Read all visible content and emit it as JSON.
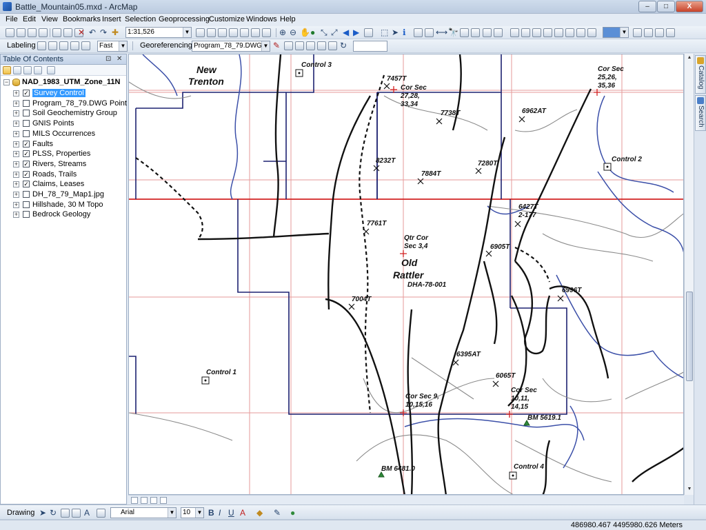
{
  "window": {
    "title": "Battle_Mountain05.mxd - ArcMap",
    "min_label": "–",
    "max_label": "□",
    "close_label": "X"
  },
  "menu": [
    "File",
    "Edit",
    "View",
    "Bookmarks",
    "Insert",
    "Selection",
    "Geoprocessing",
    "Customize",
    "Windows",
    "Help"
  ],
  "toolbar": {
    "scale_value": "1:31,526",
    "labeling_label": "Labeling",
    "quality_value": "Fast",
    "georeferencing_label": "Georeferencing",
    "layer_value": "Program_78_79.DWG Poi"
  },
  "toc": {
    "title": "Table Of Contents",
    "pin": "⊡",
    "close": "✕",
    "dataframe": "NAD_1983_UTM_Zone_11N",
    "layers": [
      {
        "label": "Survey Control",
        "checked": true,
        "selected": true
      },
      {
        "label": "Program_78_79.DWG Point",
        "checked": false,
        "selected": false
      },
      {
        "label": "Soil Geochemistry Group",
        "checked": false,
        "selected": false
      },
      {
        "label": "GNIS Points",
        "checked": false,
        "selected": false
      },
      {
        "label": "MILS Occurrences",
        "checked": false,
        "selected": false
      },
      {
        "label": "Faults",
        "checked": true,
        "selected": false
      },
      {
        "label": "PLSS, Properties",
        "checked": true,
        "selected": false
      },
      {
        "label": "Rivers, Streams",
        "checked": true,
        "selected": false
      },
      {
        "label": "Roads, Trails",
        "checked": true,
        "selected": false
      },
      {
        "label": "Claims, Leases",
        "checked": true,
        "selected": false
      },
      {
        "label": "DH_78_79_Map1.jpg",
        "checked": false,
        "selected": false
      },
      {
        "label": "Hillshade, 30 M Topo",
        "checked": false,
        "selected": false
      },
      {
        "label": "Bedrock Geology",
        "checked": false,
        "selected": false
      }
    ]
  },
  "map_labels": {
    "new_trenton_1": "New",
    "new_trenton_2": "Trenton",
    "control_3": "Control 3",
    "t7457": "7457T",
    "corsec_27_a": "Cor Sec",
    "corsec_27_b": "27,28,",
    "corsec_27_c": "33,34",
    "corsec_25_a": "Cor Sec",
    "corsec_25_b": "25,26,",
    "corsec_25_c": "35,36",
    "t7738": "7738T",
    "t6962": "6962AT",
    "control_2": "Control 2",
    "t8232": "8232T",
    "t7884": "7884T",
    "t7280": "7280T",
    "t6427_a": "6427T",
    "t6427_b": "2-177",
    "t7761": "7761T",
    "qtr_a": "Qtr Cor",
    "qtr_b": "Sec 3,4",
    "t6905": "6905T",
    "old_rattler_1": "Old",
    "old_rattler_2": "Rattler",
    "dha": "DHA-78-001",
    "t6996": "6996T",
    "t7004": "7004T",
    "t6395": "6395AT",
    "control_1": "Control 1",
    "t6065": "6065T",
    "corsec_9_a": "Cor Sec 9,",
    "corsec_9_b": "10,15,16",
    "corsec_10_a": "Cor Sec",
    "corsec_10_b": "10,11,",
    "corsec_10_c": "14,15",
    "bm5619": "BM 5619.1",
    "bm6481": "BM 6481.0",
    "control_4": "Control 4"
  },
  "draw": {
    "drawing_label": "Drawing",
    "font_value": "Arial",
    "size_value": "10"
  },
  "status": {
    "coordinates": "486980.467  4495980.626 Meters"
  },
  "dock": {
    "catalog": "Catalog",
    "search": "Search"
  }
}
